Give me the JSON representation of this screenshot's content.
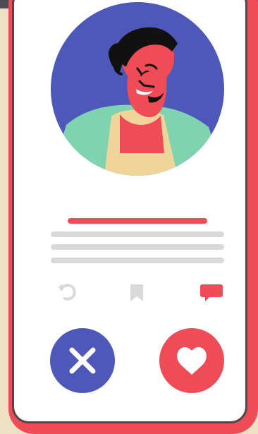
{
  "colors": {
    "background": "#ede0c4",
    "phone_border": "#ef4c57",
    "screen": "#ffffff",
    "accent_blue": "#4d58b8",
    "accent_red": "#ef4c57",
    "text_placeholder": "#d9d9da",
    "skin": "#ef4c57",
    "shirt": "#7fd3b0",
    "undershirt": "#f0d59a",
    "hair": "#111111"
  },
  "icons": {
    "refresh": "refresh-icon",
    "bookmark": "bookmark-icon",
    "message": "message-icon",
    "reject": "close-icon",
    "like": "heart-icon"
  }
}
